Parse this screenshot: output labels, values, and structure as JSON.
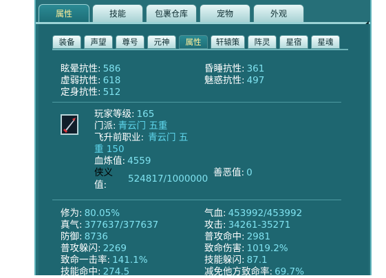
{
  "top_tabs": [
    "属性",
    "技能",
    "包裹仓库",
    "宠物",
    "外观"
  ],
  "sub_tabs": [
    "装备",
    "声望",
    "尊号",
    "元神",
    "属性",
    "轩辕策",
    "阵灵",
    "星宿",
    "星魂"
  ],
  "resistances": {
    "row1_label_a": "眩晕抗性:",
    "row1_val_a": "586",
    "row1_label_b": "昏睡抗性:",
    "row1_val_b": "361",
    "row2_label_a": "虚弱抗性:",
    "row2_val_a": "618",
    "row2_label_b": "魅惑抗性:",
    "row2_val_b": "497",
    "row3_label_a": "定身抗性:",
    "row3_val_a": "512"
  },
  "profile": {
    "level_label": "玩家等级:",
    "level_value": "165",
    "sect_label": "门派:",
    "sect_value": "青云门 五重",
    "prev_class_label": "飞升前职业:",
    "prev_class_value_a": "青云门 五",
    "prev_class_value_b": "重 150",
    "blood_label": "血炼值:",
    "blood_value": "4559",
    "chivalry_label_a": "侠义",
    "chivalry_label_b": "值:",
    "chivalry_value": "524817/1000000",
    "karma_label": "善恶值:",
    "karma_value": "0"
  },
  "stats": {
    "cultivation_label": "修为:",
    "cultivation_value": "80.05%",
    "hp_label": "气血:",
    "hp_value": "453992/453992",
    "qi_label": "真气:",
    "qi_value": "377637/377637",
    "attack_label": "攻击:",
    "attack_value": "34261-35271",
    "defense_label": "防御:",
    "defense_value": "8736",
    "hit_label": "普攻命中:",
    "hit_value": "2981",
    "dodge_label": "普攻躲闪:",
    "dodge_value": "2269",
    "critdmg_label": "致命伤害:",
    "critdmg_value": "1019.2%",
    "crit_label": "致命一击率:",
    "crit_value": "141.1%",
    "skilldodge_label": "技能躲闪:",
    "skilldodge_value": "87.1",
    "skillhit_label": "技能命中:",
    "skillhit_value": "274.5",
    "reduce_label": "减免他方致命率:",
    "reduce_value": "69.7%"
  }
}
